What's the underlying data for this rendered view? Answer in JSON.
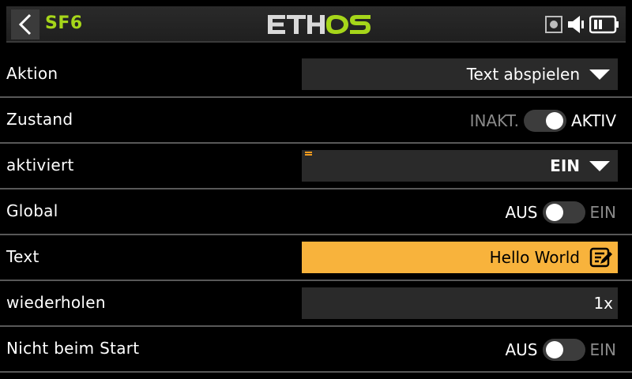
{
  "header": {
    "title": "SF6",
    "logo_text": "ETHOS",
    "back_icon": "chevron-left-icon",
    "status_icons": [
      "record-icon",
      "speaker-icon",
      "battery-icon"
    ],
    "accent_color": "#a6d61a"
  },
  "rows": [
    {
      "label": "Aktion",
      "type": "dropdown",
      "value": "Text abspielen"
    },
    {
      "label": "Zustand",
      "type": "toggle",
      "off_label": "INAKT.",
      "on_label": "AKTIV",
      "state": "on"
    },
    {
      "label": "aktiviert",
      "type": "dropdown",
      "value": "EIN"
    },
    {
      "label": "Global",
      "type": "toggle",
      "off_label": "AUS",
      "on_label": "EIN",
      "state": "off"
    },
    {
      "label": "Text",
      "type": "text-edit",
      "value": "Hello World",
      "icon": "edit-note-icon",
      "highlight_color": "#f8b33c"
    },
    {
      "label": "wiederholen",
      "type": "number",
      "value": "1x"
    },
    {
      "label": "Nicht beim Start",
      "type": "toggle",
      "off_label": "AUS",
      "on_label": "EIN",
      "state": "off"
    }
  ]
}
